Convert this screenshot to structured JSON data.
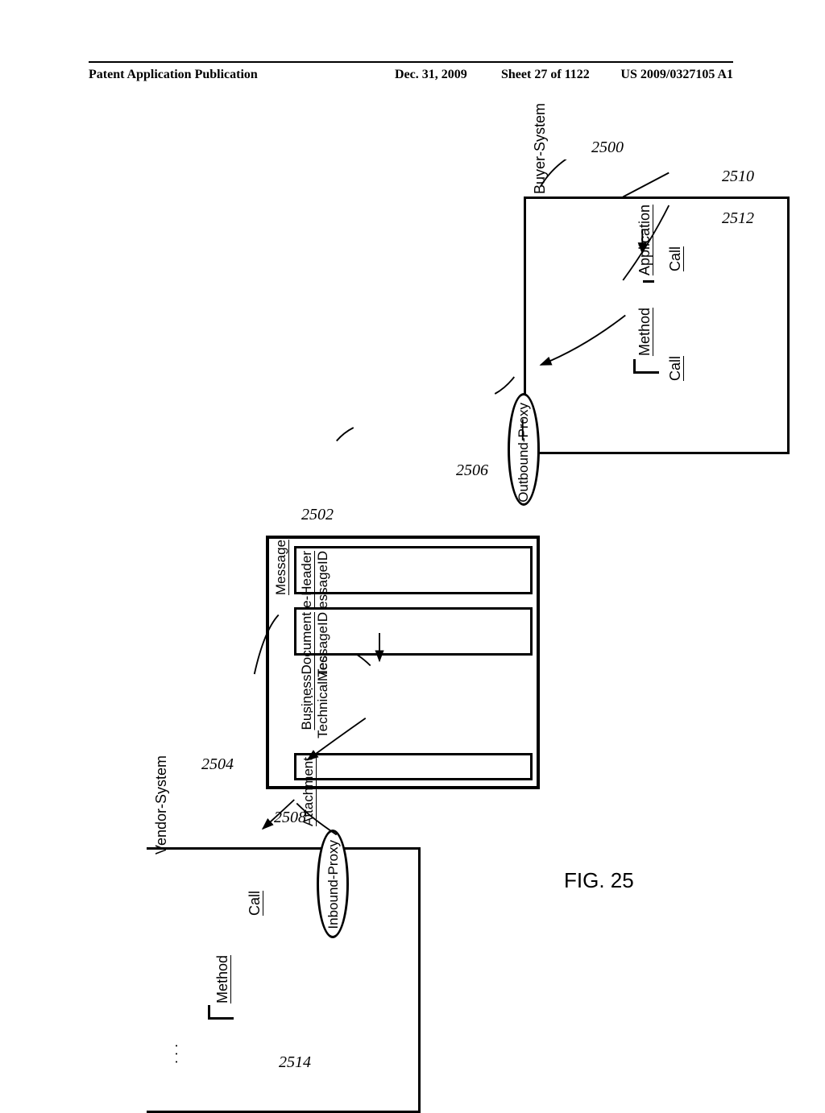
{
  "header": {
    "left": "Patent Application Publication",
    "date": "Dec. 31, 2009",
    "sheet": "Sheet 27 of 1122",
    "pubno": "US 2009/0327105 A1"
  },
  "fig": {
    "caption": "FIG. 25",
    "refs": {
      "buyer": "2500",
      "msg": "2502",
      "vendor": "2504",
      "outProxy": "2506",
      "inProxy": "2508",
      "application": "2510",
      "methodBuyer": "2512",
      "methodVendor": "2514"
    },
    "buyer": {
      "title": "Buyer-System",
      "application": "Application",
      "call1": "Call",
      "method": "Method",
      "call2": "Call",
      "proxy": "Outbound-Proxy"
    },
    "message": {
      "title": "Message",
      "header": "Message-Header",
      "headerField": "TechnicalMessageID",
      "doc": "BusinessDocument",
      "docField": "TechnicalMessageID",
      "dots": ". . . .",
      "attachment": "Attachment"
    },
    "vendor": {
      "title": "Vendor-System",
      "proxy": "Inbound-Proxy",
      "call": "Call",
      "method": "Method",
      "dots": ". . ."
    }
  }
}
